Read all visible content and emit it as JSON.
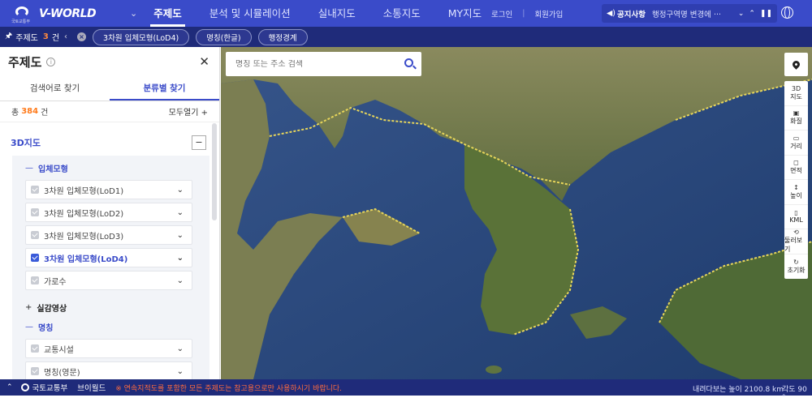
{
  "header": {
    "logo_sub": "국토교통부",
    "brand": "V-WORLD",
    "menu": [
      {
        "label": "주제도",
        "active": true
      },
      {
        "label": "분석 및 시뮬레이션",
        "active": false
      },
      {
        "label": "실내지도",
        "active": false
      },
      {
        "label": "소통지도",
        "active": false
      },
      {
        "label": "MY지도",
        "active": false
      }
    ],
    "login": "로그인",
    "signup": "회원가입",
    "notice_label": "공지사항",
    "notice_text": "행정구역명 변경에 ···"
  },
  "subbar": {
    "title": "주제도",
    "count": "3",
    "unit": "건",
    "chips": [
      "3차원 입체모형(LoD4)",
      "명칭(한글)",
      "행정경계"
    ]
  },
  "sidebar": {
    "title": "주제도",
    "tabs": [
      {
        "label": "검색어로 찾기",
        "active": false
      },
      {
        "label": "분류별 찾기",
        "active": true
      }
    ],
    "total_prefix": "총",
    "total_count": "384",
    "total_unit": "건",
    "expand_all": "모두열기 +",
    "category": "3D지도",
    "groups": [
      {
        "label": "입체모형",
        "expanded": true,
        "items": [
          {
            "label": "3차원 입체모형(LoD1)",
            "checked": false
          },
          {
            "label": "3차원 입체모형(LoD2)",
            "checked": false
          },
          {
            "label": "3차원 입체모형(LoD3)",
            "checked": false
          },
          {
            "label": "3차원 입체모형(LoD4)",
            "checked": true
          },
          {
            "label": "가로수",
            "checked": false
          }
        ]
      },
      {
        "label": "실감영상",
        "expanded": false,
        "items": []
      },
      {
        "label": "명칭",
        "expanded": true,
        "items": [
          {
            "label": "교통시설",
            "checked": false
          },
          {
            "label": "명칭(영문)",
            "checked": false
          }
        ]
      }
    ]
  },
  "map": {
    "search_placeholder": "명칭 또는 주소 검색",
    "tools": [
      {
        "icon": "3D",
        "label": "지도"
      },
      {
        "icon": "▣",
        "label": "화질"
      },
      {
        "icon": "▭",
        "label": "거리"
      },
      {
        "icon": "◻",
        "label": "면적"
      },
      {
        "icon": "↕",
        "label": "높이"
      },
      {
        "icon": "▯",
        "label": "KML"
      },
      {
        "icon": "⟲",
        "label": "둘러보기"
      },
      {
        "icon": "↻",
        "label": "초기화"
      }
    ]
  },
  "footer": {
    "ministry": "국토교통부",
    "vworld": "브이월드",
    "warning": "※ 연속지적도를 포함한 모든 주제도는 참고용으로만 사용하시기 바랍니다.",
    "elevation": "내려다보는 높이 2100.8 km",
    "angle": "각도 90 °"
  },
  "colors": {
    "primary": "#3a4bc9",
    "dark": "#1f2b7a",
    "accent": "#ff7a1a"
  }
}
